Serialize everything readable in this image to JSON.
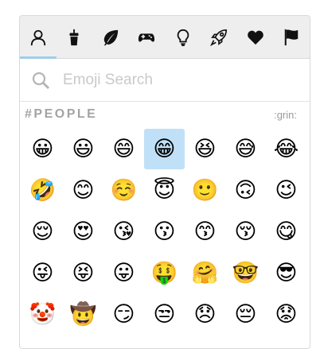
{
  "tabs": [
    {
      "id": "people",
      "icon": "person-outline-icon",
      "active": true
    },
    {
      "id": "food",
      "icon": "cup-icon",
      "active": false
    },
    {
      "id": "nature",
      "icon": "leaf-icon",
      "active": false
    },
    {
      "id": "activity",
      "icon": "gamepad-icon",
      "active": false
    },
    {
      "id": "objects",
      "icon": "lightbulb-icon",
      "active": false
    },
    {
      "id": "travel",
      "icon": "rocket-icon",
      "active": false
    },
    {
      "id": "symbols",
      "icon": "heart-icon",
      "active": false
    },
    {
      "id": "flags",
      "icon": "flag-icon",
      "active": false
    }
  ],
  "search": {
    "icon": "search-icon",
    "placeholder": "Emoji Search",
    "value": ""
  },
  "category": {
    "title": "#PEOPLE",
    "hover_shortcode": ":grin:"
  },
  "emojis": [
    {
      "char": "😀",
      "selected": false
    },
    {
      "char": "😃",
      "selected": false
    },
    {
      "char": "😄",
      "selected": false
    },
    {
      "char": "😁",
      "selected": true
    },
    {
      "char": "😆",
      "selected": false
    },
    {
      "char": "😅",
      "selected": false
    },
    {
      "char": "😂",
      "selected": false
    },
    {
      "char": "🤣",
      "selected": false
    },
    {
      "char": "😊",
      "selected": false
    },
    {
      "char": "☺️",
      "selected": false
    },
    {
      "char": "😇",
      "selected": false
    },
    {
      "char": "🙂",
      "selected": false
    },
    {
      "char": "🙃",
      "selected": false
    },
    {
      "char": "😉",
      "selected": false
    },
    {
      "char": "😌",
      "selected": false
    },
    {
      "char": "😍",
      "selected": false
    },
    {
      "char": "😘",
      "selected": false
    },
    {
      "char": "😗",
      "selected": false
    },
    {
      "char": "😙",
      "selected": false
    },
    {
      "char": "😚",
      "selected": false
    },
    {
      "char": "😋",
      "selected": false
    },
    {
      "char": "😜",
      "selected": false
    },
    {
      "char": "😝",
      "selected": false
    },
    {
      "char": "😛",
      "selected": false
    },
    {
      "char": "🤑",
      "selected": false
    },
    {
      "char": "🤗",
      "selected": false
    },
    {
      "char": "🤓",
      "selected": false
    },
    {
      "char": "😎",
      "selected": false
    },
    {
      "char": "🤡",
      "selected": false
    },
    {
      "char": "🤠",
      "selected": false
    },
    {
      "char": "😏",
      "selected": false
    },
    {
      "char": "😒",
      "selected": false
    },
    {
      "char": "😞",
      "selected": false
    },
    {
      "char": "😔",
      "selected": false
    },
    {
      "char": "😟",
      "selected": false
    }
  ],
  "colors": {
    "tab_bar_bg": "#eeeeee",
    "active_tab_indicator": "#9fcdea",
    "selected_cell_bg": "#c0e0f7",
    "icon_color": "#111111",
    "category_title": "#a3a3a3",
    "placeholder": "#c9c9c9"
  }
}
